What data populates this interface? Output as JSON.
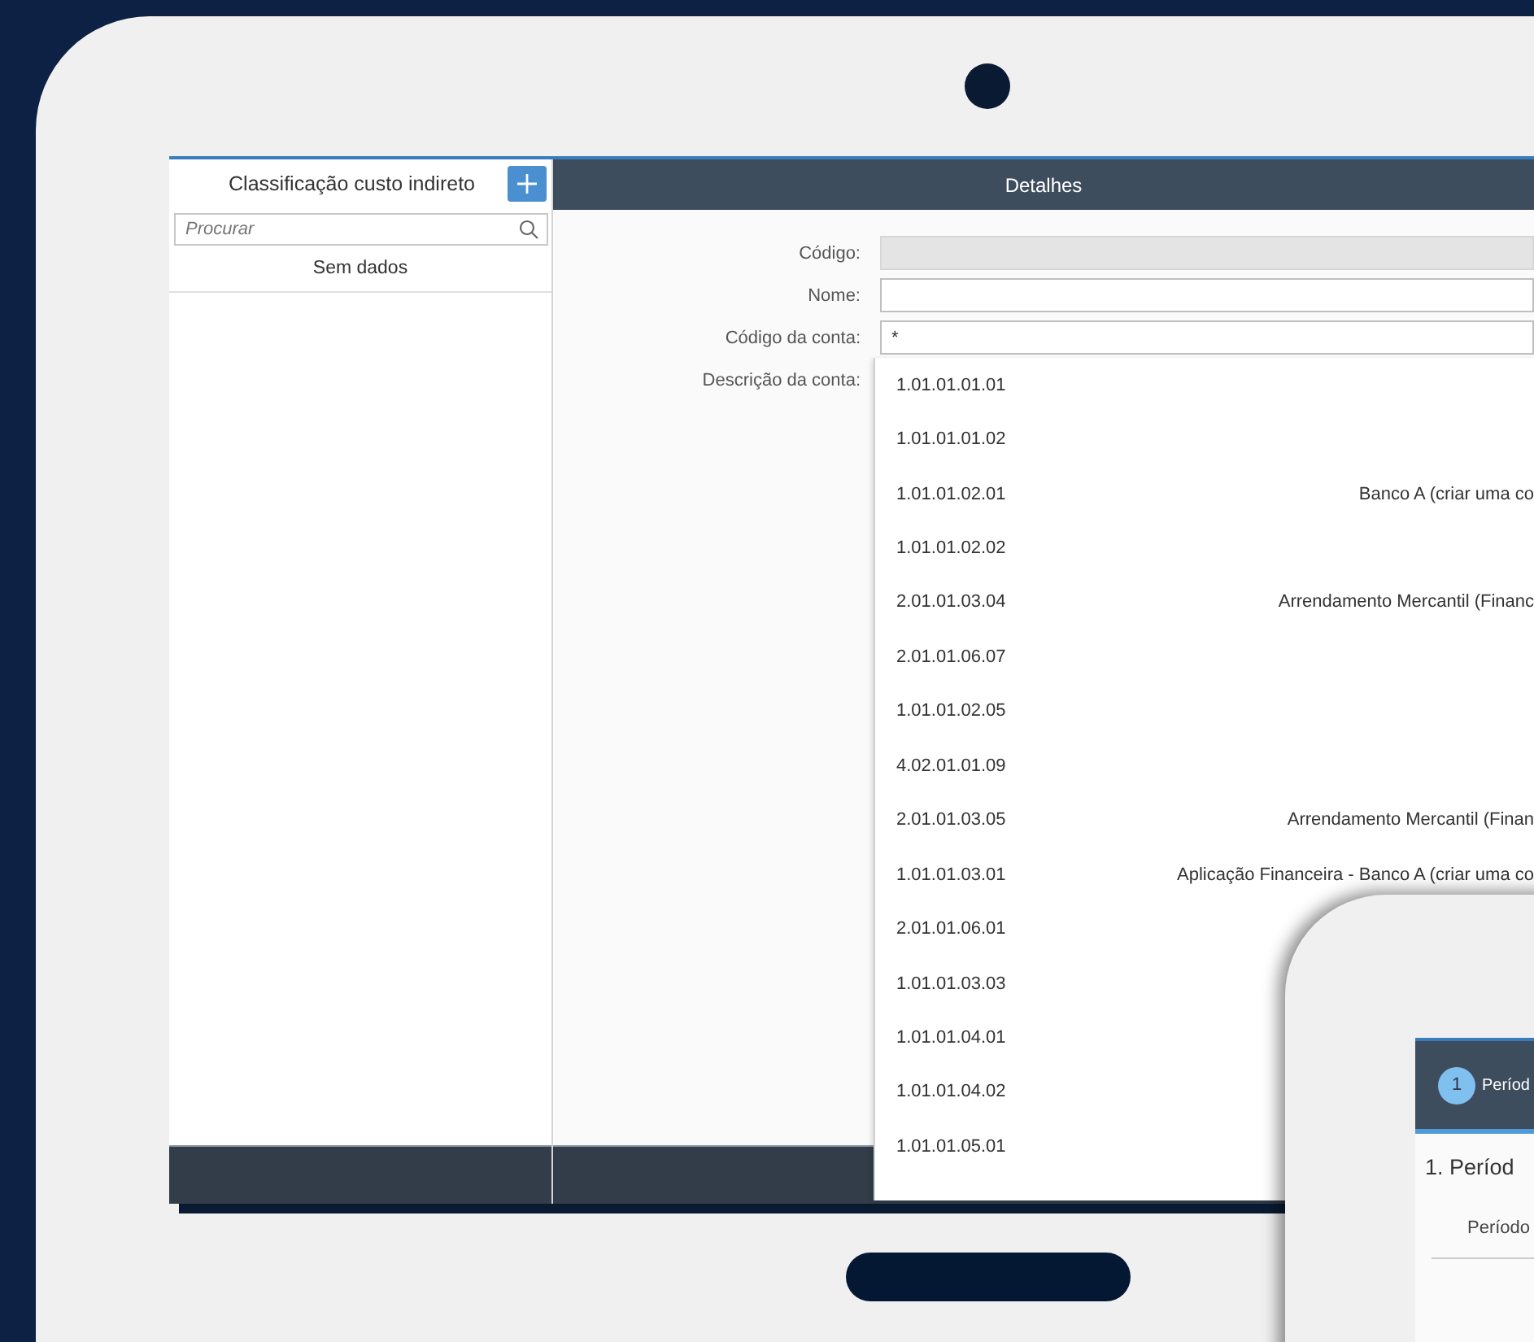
{
  "left_panel": {
    "title": "Classificação custo indireto",
    "search": {
      "placeholder": "Procurar"
    },
    "empty_text": "Sem dados"
  },
  "details": {
    "title": "Detalhes",
    "fields": [
      {
        "label": "Código:",
        "disabled": true
      },
      {
        "label": "Nome:",
        "disabled": false
      },
      {
        "label": "Código da conta:",
        "value": "*",
        "disabled": false
      },
      {
        "label": "Descrição da conta:"
      }
    ]
  },
  "account_dropdown": {
    "items": [
      {
        "code": "1.01.01.01.01"
      },
      {
        "code": "1.01.01.01.02"
      },
      {
        "code": "1.01.01.02.01",
        "description": "Banco A (criar uma co"
      },
      {
        "code": "1.01.01.02.02"
      },
      {
        "code": "2.01.01.03.04",
        "description": "Arrendamento Mercantil (Financ"
      },
      {
        "code": "2.01.01.06.07"
      },
      {
        "code": "1.01.01.02.05"
      },
      {
        "code": "4.02.01.01.09"
      },
      {
        "code": "2.01.01.03.05",
        "description": "Arrendamento Mercantil (Finan"
      },
      {
        "code": "1.01.01.03.01",
        "description": "Aplicação Financeira - Banco A (criar uma co"
      },
      {
        "code": "2.01.01.06.01"
      },
      {
        "code": "1.01.01.03.03"
      },
      {
        "code": "1.01.01.04.01"
      },
      {
        "code": "1.01.01.04.02"
      },
      {
        "code": "1.01.01.05.01"
      }
    ]
  },
  "second_device": {
    "steps": [
      {
        "number": "1",
        "label": "Períod",
        "selected": true
      }
    ],
    "heading": "1. Períod",
    "field_label": "Período"
  }
}
